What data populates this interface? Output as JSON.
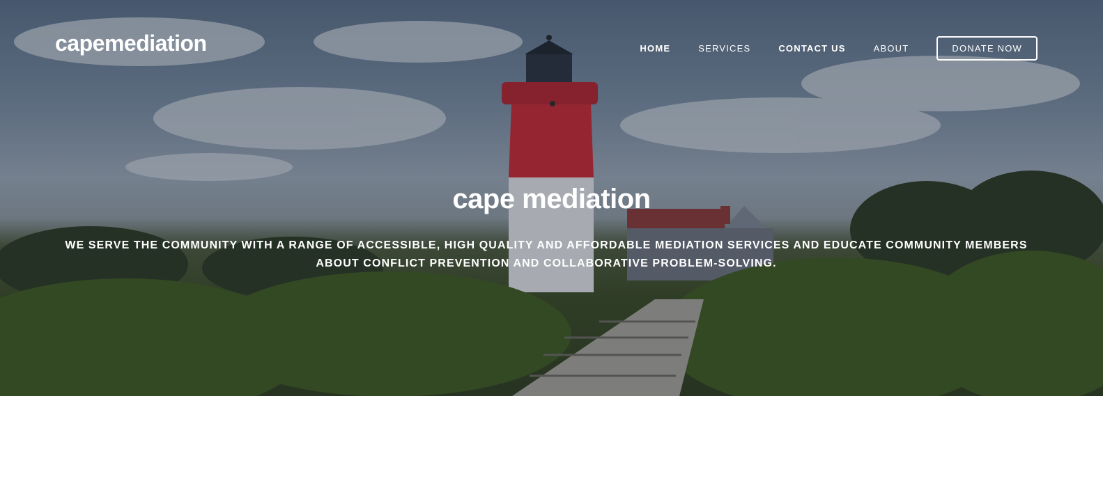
{
  "brand": {
    "name": "capemediation"
  },
  "nav": {
    "items": [
      {
        "label": "HOME"
      },
      {
        "label": "SERVICES"
      },
      {
        "label": "CONTACT US"
      },
      {
        "label": "ABOUT"
      }
    ],
    "donate_label": "DONATE NOW"
  },
  "hero": {
    "title": "cape mediation",
    "subtitle": "WE SERVE THE COMMUNITY WITH A RANGE OF ACCESSIBLE, HIGH QUALITY AND AFFORDABLE MEDIATION SERVICES AND EDUCATE COMMUNITY MEMBERS ABOUT CONFLICT PREVENTION AND COLLABORATIVE PROBLEM-SOLVING.",
    "background_image": "lighthouse-landscape-photo"
  }
}
